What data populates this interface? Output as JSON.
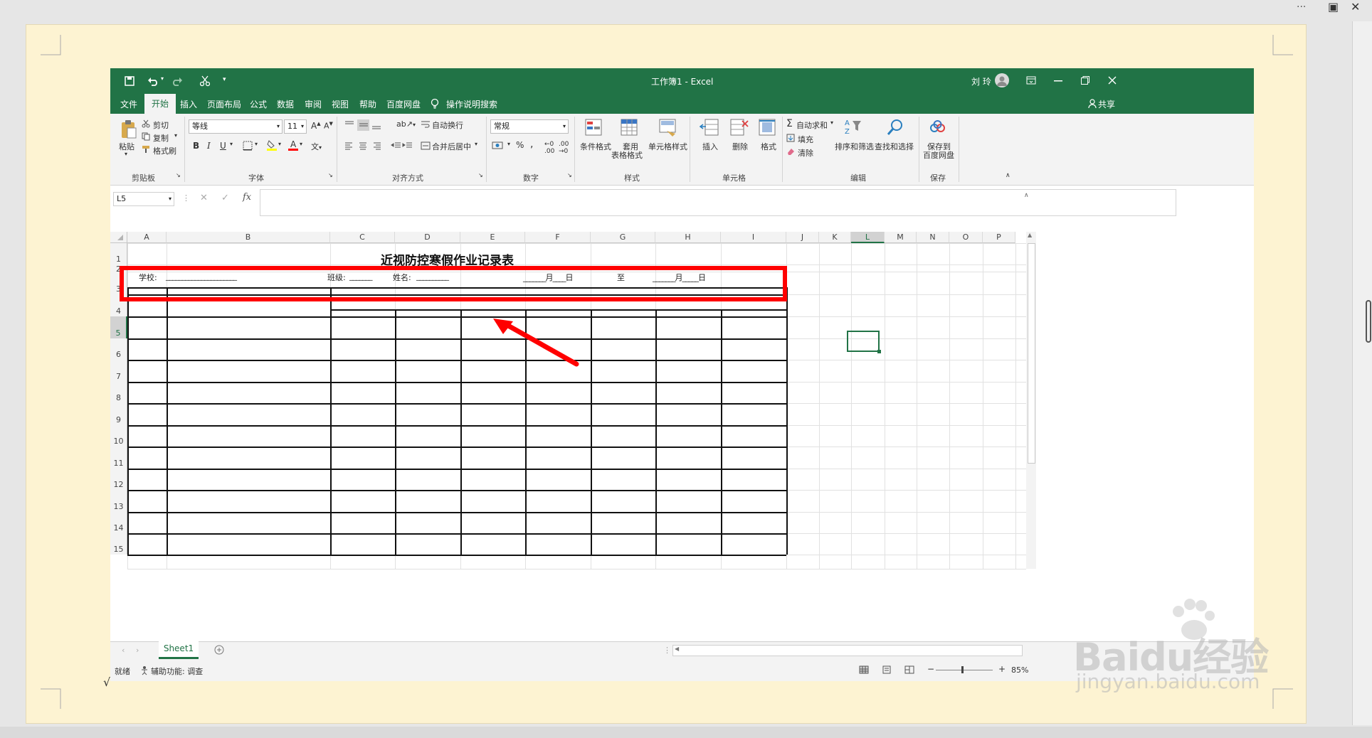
{
  "outer_controls": {
    "more": "···",
    "restore": "▣",
    "close": "✕"
  },
  "page_mark": "√",
  "excel": {
    "doc_title": "工作簿1 - Excel",
    "user": "刘 玲",
    "tabs": [
      "文件",
      "开始",
      "插入",
      "页面布局",
      "公式",
      "数据",
      "审阅",
      "视图",
      "帮助",
      "百度网盘"
    ],
    "active_tab": "开始",
    "search": "操作说明搜索",
    "share": "共享",
    "clipboard": {
      "paste": "粘贴",
      "cut": "剪切",
      "copy": "复制",
      "painter": "格式刷",
      "group": "剪贴板"
    },
    "font": {
      "name": "等线",
      "size": "11",
      "bold": "B",
      "italic": "I",
      "underline": "U",
      "group": "字体"
    },
    "align": {
      "wrap": "自动换行",
      "merge": "合并后居中",
      "group": "对齐方式"
    },
    "number": {
      "format": "常规",
      "percent": "%",
      "group": "数字"
    },
    "styles": {
      "cond": "条件格式",
      "table1": "套用",
      "table2": "表格格式",
      "cell": "单元格样式",
      "group": "样式"
    },
    "cells": {
      "insert": "插入",
      "delete": "删除",
      "format": "格式",
      "group": "单元格"
    },
    "editing": {
      "autosum": "自动求和",
      "fill": "填充",
      "clear": "清除",
      "sort": "排序和筛选",
      "find": "查找和选择",
      "group": "编辑"
    },
    "save": {
      "label1": "保存到",
      "label2": "百度网盘",
      "group": "保存"
    },
    "name_box": "L5",
    "fx": "fx",
    "columns": [
      "A",
      "B",
      "C",
      "D",
      "E",
      "F",
      "G",
      "H",
      "I",
      "J",
      "K",
      "L",
      "M",
      "N",
      "O",
      "P"
    ],
    "rows": [
      "1",
      "2",
      "3",
      "4",
      "5",
      "6",
      "7",
      "8",
      "9",
      "10",
      "11",
      "12",
      "13",
      "14",
      "15"
    ],
    "sheet": {
      "title": "近视防控寒假作业记录表",
      "school": "学校:",
      "school_line": "______________________",
      "class": "班级:",
      "class_line": "_______",
      "name": "姓名:",
      "name_line": "__________",
      "date_from": "_______月____日",
      "to": "至",
      "date_to": "_______月_____日"
    },
    "sheet_tab": "Sheet1",
    "status": {
      "ready": "就绪",
      "accessibility": "辅助功能: 调查",
      "zoom": "85%"
    }
  },
  "watermark": {
    "brand": "Baidu经验",
    "url": "jingyan.baidu.com"
  }
}
